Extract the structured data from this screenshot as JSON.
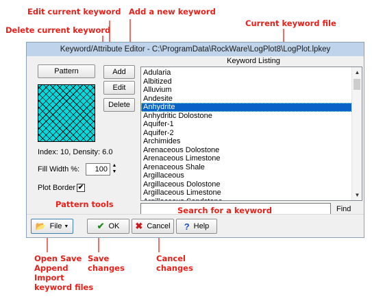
{
  "window": {
    "title": "Keyword/Attribute Editor - C:\\ProgramData\\RockWare\\LogPlot8\\LogPlot.lpkey"
  },
  "pattern_panel": {
    "pattern_button": "Pattern",
    "index_density": "Index: 10, Density: 6.0",
    "fill_width_label": "Fill Width %:",
    "fill_width_value": "100",
    "plot_border_label": "Plot Border",
    "plot_border_checked": "✔",
    "pattern_color": "#00d9dd"
  },
  "keyword_buttons": {
    "add": "Add",
    "edit": "Edit",
    "delete": "Delete"
  },
  "keyword_listing": {
    "header": "Keyword Listing",
    "items": [
      "Adularia",
      "Albitized",
      "Alluvium",
      "Andesite",
      "Anhydrite",
      "Anhydritic Dolostone",
      "Aquifer-1",
      "Aquifer-2",
      "Archimides",
      "Arenaceous Dolostone",
      "Arenaceous Limestone",
      "Arenaceous Shale",
      "Argillaceous",
      "Argillaceous Dolostone",
      "Argillaceous Limestone",
      "Argillaceous Sandstone"
    ],
    "selected_index": 4,
    "selection_color": "#0a62c9"
  },
  "search": {
    "value": "",
    "find_label": "Find"
  },
  "bottom_buttons": {
    "file": "File",
    "ok": "OK",
    "cancel": "Cancel",
    "help": "Help"
  },
  "annotations": {
    "edit_current": "Edit current keyword",
    "add_new": "Add a new keyword",
    "delete_current": "Delete current keyword",
    "keyword_file": "Current keyword file",
    "current_keyword": "current keyword",
    "search_hint": "Search for a keyword",
    "pattern_tools": "Pattern tools",
    "file_ops": "Open Save Append Import keyword files",
    "save_changes": "Save changes",
    "cancel_changes": "Cancel changes",
    "annotation_color": "#e8201a"
  }
}
